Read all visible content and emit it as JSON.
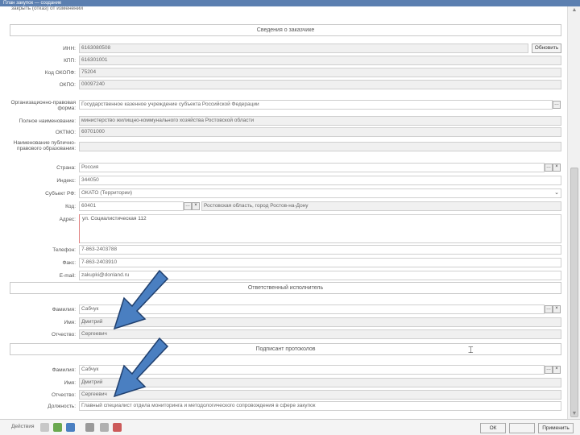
{
  "window": {
    "title": "План закупок — создание"
  },
  "top_line": "закрыть (отказ) от изменений",
  "sections": {
    "org_info": "Сведения о заказчике",
    "responsible": "Ответственный исполнитель",
    "signer": "Подписант протоколов"
  },
  "org": {
    "inn_label": "ИНН:",
    "inn": "6163080508",
    "check_btn": "Обновить",
    "kpp_label": "КПП:",
    "kpp": "616301001",
    "okopf_label": "Код ОКОПФ:",
    "okopf": "75204",
    "okpo_label": "ОКПО:",
    "okpo": "00097240",
    "opf_label": "Организационно-правовая форма:",
    "opf": "Государственное казенное учреждение субъекта Российской Федерации",
    "fullname_label": "Полное наименование:",
    "fullname": "министерство жилищно-коммунального хозяйства Ростовской области",
    "oktmo_label": "ОКТМО:",
    "oktmo": "60701000",
    "settlement_label": "Наименование публично-правового образования:",
    "settlement": "",
    "country_label": "Страна:",
    "country": "Россия",
    "index_label": "Индекс:",
    "index": "344050",
    "region_label": "Субъект РФ:",
    "region": "ОКАТО (Территории)",
    "code_label": "Код:",
    "code": "60401",
    "code_desc": "Ростовская область, город Ростов-на-Дону",
    "address_label": "Адрес:",
    "address": "ул. Социалистическая 112",
    "phone_label": "Телефон:",
    "phone": "7-863-2403788",
    "fax_label": "Факс:",
    "fax": "7-863-2403910",
    "email_label": "E-mail:",
    "email": "zakupki@donland.ru"
  },
  "responsible": {
    "last_label": "Фамилия:",
    "last": "Сабчук",
    "first_label": "Имя:",
    "first": "Дмитрий",
    "middle_label": "Отчество:",
    "middle": "Сергеевич"
  },
  "signer": {
    "last_label": "Фамилия:",
    "last": "Сабчук",
    "first_label": "Имя:",
    "first": "Дмитрий",
    "middle_label": "Отчество:",
    "middle": "Сергеевич",
    "position_label": "Должность:",
    "position": "Главный специалист отдела мониторинга и методологического сопровождения в сфере закупок"
  },
  "bottom": {
    "actions": "Действия",
    "ok": "ОК",
    "apply": "Применить"
  },
  "colors": {
    "arrow": "#4a7fc1",
    "arrow_stroke": "#1f3f6e",
    "titlebar": "#5b7fb0"
  }
}
